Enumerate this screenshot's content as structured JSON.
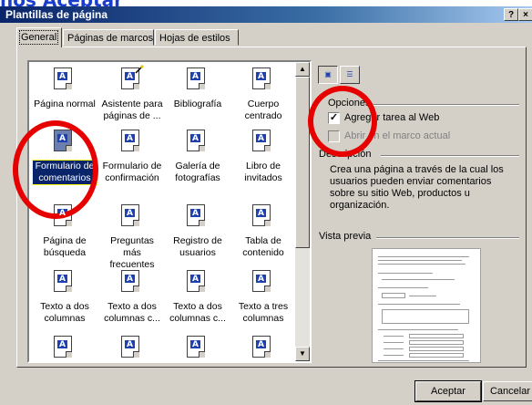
{
  "caption": {
    "prefix": "nos ",
    "accent": "Aceptar"
  },
  "window": {
    "title": "Plantillas de página",
    "help": "?",
    "close": "×"
  },
  "tabs": [
    {
      "label": "General",
      "active": true
    },
    {
      "label": "Páginas de marcos",
      "active": false
    },
    {
      "label": "Hojas de estilos",
      "active": false
    }
  ],
  "templates": [
    {
      "label": "Página normal",
      "icon": "page-icon"
    },
    {
      "label": "Asistente para páginas de ...",
      "icon": "wizard-icon"
    },
    {
      "label": "Bibliografía",
      "icon": "page-icon"
    },
    {
      "label": "Cuerpo centrado",
      "icon": "page-icon"
    },
    {
      "label": "Formulario de comentarios",
      "icon": "page-icon",
      "selected": true
    },
    {
      "label": "Formulario de confirmación",
      "icon": "page-icon"
    },
    {
      "label": "Galería de fotografías",
      "icon": "page-icon"
    },
    {
      "label": "Libro de invitados",
      "icon": "page-icon"
    },
    {
      "label": "Página de búsqueda",
      "icon": "page-icon"
    },
    {
      "label": "Preguntas más frecuentes",
      "icon": "page-icon"
    },
    {
      "label": "Registro de usuarios",
      "icon": "page-icon"
    },
    {
      "label": "Tabla de contenido",
      "icon": "page-icon"
    },
    {
      "label": "Texto a dos columnas",
      "icon": "page-icon"
    },
    {
      "label": "Texto a dos columnas c...",
      "icon": "page-icon"
    },
    {
      "label": "Texto a dos columnas c...",
      "icon": "page-icon"
    },
    {
      "label": "Texto a tres columnas",
      "icon": "page-icon"
    },
    {
      "label": "",
      "icon": "page-icon"
    },
    {
      "label": "",
      "icon": "page-icon"
    },
    {
      "label": "",
      "icon": "page-icon"
    },
    {
      "label": "",
      "icon": "page-icon"
    }
  ],
  "options": {
    "heading": "Opciones",
    "add_task": {
      "label": "Agregar tarea al Web",
      "checked": true,
      "enabled": true
    },
    "open_frame": {
      "label": "Abrir en el marco actual",
      "checked": false,
      "enabled": false
    }
  },
  "description": {
    "heading": "Descripción",
    "text": "Crea una página a través de la cual los usuarios pueden enviar comentarios sobre su sitio Web, productos u organización."
  },
  "preview": {
    "heading": "Vista previa"
  },
  "buttons": {
    "ok": "Aceptar",
    "cancel": "Cancelar"
  },
  "colors": {
    "highlight_ring": "#e60000",
    "titlebar": "#0a246a",
    "selection": "#0a246a"
  }
}
